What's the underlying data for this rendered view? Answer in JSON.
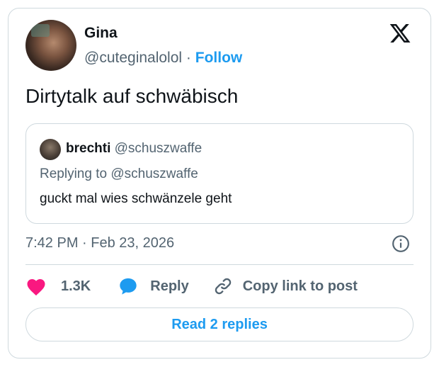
{
  "author": {
    "name": "Gina",
    "handle": "@cuteginalolol",
    "separator": "·",
    "follow_label": "Follow"
  },
  "tweet": {
    "text": "Dirtytalk auf schwäbisch",
    "timestamp": "7:42 PM · Feb 23, 2026"
  },
  "quoted": {
    "name": "brechti",
    "handle": "@schuszwaffe",
    "replying_to": "Replying to @schuszwaffe",
    "text": "guckt mal wies schwänzele geht"
  },
  "actions": {
    "likes": "1.3K",
    "reply_label": "Reply",
    "copy_label": "Copy link to post"
  },
  "read_replies_label": "Read 2 replies",
  "icons": {
    "logo": "x-logo-icon",
    "info": "info-icon",
    "like": "heart-icon",
    "reply": "speech-bubble-icon",
    "copy": "link-icon"
  },
  "colors": {
    "accent": "#1d9bf0",
    "like": "#f91880",
    "text": "#0f1419",
    "secondary": "#536471",
    "border": "#cfd9de"
  }
}
